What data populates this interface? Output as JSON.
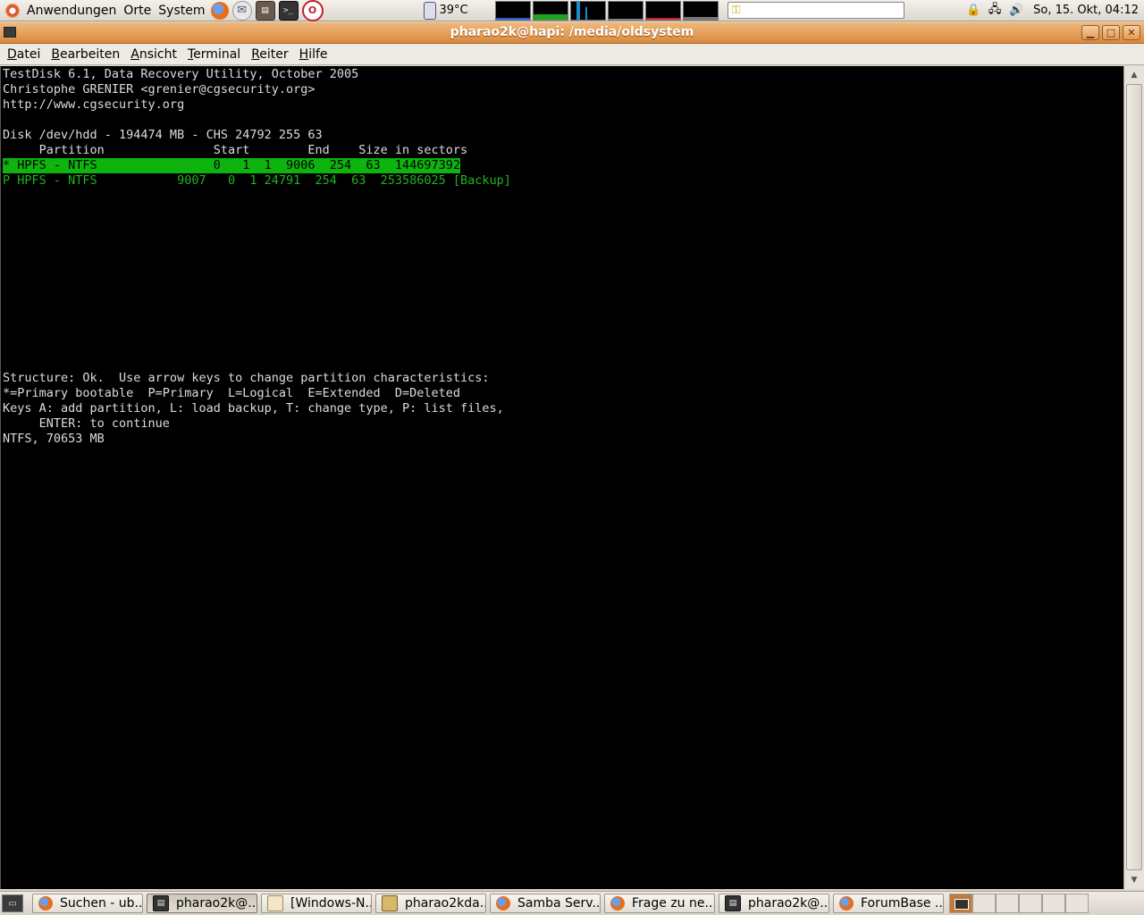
{
  "top_panel": {
    "menus": [
      "Anwendungen",
      "Orte",
      "System"
    ],
    "temperature": "39°C",
    "clock": "So, 15. Okt, 04:12"
  },
  "window": {
    "title": "pharao2k@hapi: /media/oldsystem",
    "menu": [
      {
        "label": "Datei",
        "u": "D",
        "rest": "atei"
      },
      {
        "label": "Bearbeiten",
        "u": "B",
        "rest": "earbeiten"
      },
      {
        "label": "Ansicht",
        "u": "A",
        "rest": "nsicht"
      },
      {
        "label": "Terminal",
        "u": "T",
        "rest": "erminal"
      },
      {
        "label": "Reiter",
        "u": "R",
        "rest": "eiter"
      },
      {
        "label": "Hilfe",
        "u": "H",
        "rest": "ilfe"
      }
    ]
  },
  "terminal": {
    "lines": [
      "TestDisk 6.1, Data Recovery Utility, October 2005",
      "Christophe GRENIER <grenier@cgsecurity.org>",
      "http://www.cgsecurity.org",
      "",
      "Disk /dev/hdd - 194474 MB - CHS 24792 255 63",
      "     Partition               Start        End    Size in sectors"
    ],
    "selected_row": "* HPFS - NTFS                0   1  1  9006  254  63  144697392",
    "second_row": "P HPFS - NTFS           9007   0  1 24791  254  63  253586025 [Backup]",
    "footer_lines": [
      "Structure: Ok.  Use arrow keys to change partition characteristics:",
      "*=Primary bootable  P=Primary  L=Logical  E=Extended  D=Deleted",
      "Keys A: add partition, L: load backup, T: change type, P: list files,",
      "     ENTER: to continue",
      "NTFS, 70653 MB"
    ]
  },
  "taskbar": {
    "tasks": [
      {
        "label": "Suchen - ub...",
        "icon": "firefox-icon"
      },
      {
        "label": "pharao2k@...",
        "icon": "terminal-icon",
        "active": true
      },
      {
        "label": "[Windows-N...",
        "icon": "folder-icon"
      },
      {
        "label": "pharao2kda...",
        "icon": "archive-icon"
      },
      {
        "label": "Samba Serv...",
        "icon": "firefox-icon"
      },
      {
        "label": "Frage zu ne...",
        "icon": "firefox-icon"
      },
      {
        "label": "pharao2k@...",
        "icon": "terminal-icon"
      },
      {
        "label": "ForumBase ...",
        "icon": "firefox-icon"
      }
    ]
  },
  "colors": {
    "titlebar": "#e29a52",
    "terminal_bg": "#000000",
    "terminal_fg": "#dcdcdc",
    "partition_green": "#1fb31f"
  }
}
